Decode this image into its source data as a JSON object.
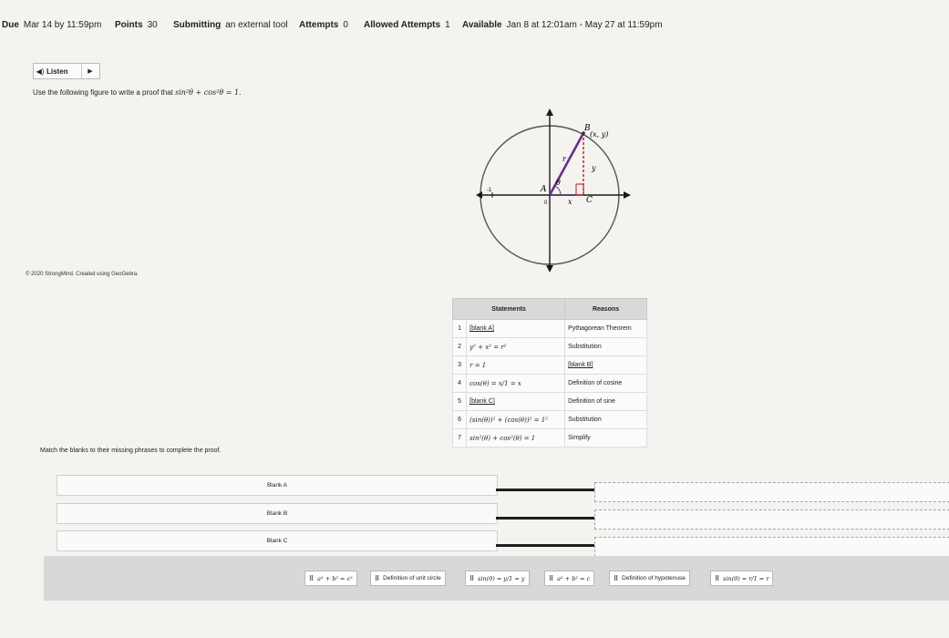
{
  "assignment": {
    "due_label": "Due",
    "due_value": "Mar 14 by 11:59pm",
    "points_label": "Points",
    "points_value": "30",
    "submitting_label": "Submitting",
    "submitting_value": "an external tool",
    "attempts_label": "Attempts",
    "attempts_value": "0",
    "allowed_label": "Allowed Attempts",
    "allowed_value": "1",
    "available_label": "Available",
    "available_value": "Jan 8 at 12:01am - May 27 at 11:59pm"
  },
  "listen": {
    "label": "Listen",
    "speaker_icon": "speaker-icon",
    "play_icon": "play-icon"
  },
  "question": {
    "prompt": "Use the following figure to write a proof that",
    "formula": "sin²θ + cos²θ = 1."
  },
  "figure": {
    "point_a": "A",
    "point_b": "B",
    "point_c": "C",
    "coord_label": "(x, y)",
    "r_label": "r",
    "y_label": "y",
    "x_label": "x",
    "theta_label": "θ",
    "origin_label": "0",
    "neg_tick": "-1",
    "copyright": "© 2020 StrongMind. Created using GeoGebra."
  },
  "proof_table": {
    "headers": [
      "Statements",
      "Reasons"
    ],
    "rows": [
      {
        "num": "1",
        "statement": "[blank A]",
        "reason": "Pythagorean Theorem"
      },
      {
        "num": "2",
        "statement": "y² + x² = r²",
        "reason": "Substitution"
      },
      {
        "num": "3",
        "statement": "r = 1",
        "reason": "[blank B]"
      },
      {
        "num": "4",
        "statement": "cos(θ) = x/1 = x",
        "reason": "Definition of cosine"
      },
      {
        "num": "5",
        "statement": "[blank C]",
        "reason": "Definition of sine"
      },
      {
        "num": "6",
        "statement": "(sin(θ))² + (cos(θ))² = 1²",
        "reason": "Substitution"
      },
      {
        "num": "7",
        "statement": "sin²(θ) + cos²(θ) = 1",
        "reason": "Simplify"
      }
    ]
  },
  "matching": {
    "instruction": "Match the blanks to their missing phrases to complete the proof.",
    "blanks": [
      "Blank A",
      "Blank B",
      "Blank C"
    ]
  },
  "answer_bank": [
    {
      "text": "a² + b² = c²",
      "math": true
    },
    {
      "text": "Definition of unit circle",
      "math": false
    },
    {
      "text": "sin(θ) = y/1 = y",
      "math": true
    },
    {
      "text": "a² + b² = c",
      "math": true
    },
    {
      "text": "Definition of hypotenuse",
      "math": false
    },
    {
      "text": "sin(θ) = r/1 = r",
      "math": true
    }
  ],
  "colors": {
    "segment_r": "#6a2f8e",
    "segment_y": "#c0141b",
    "right_angle": "#c0141b",
    "axes": "#1a1a1a",
    "circle": "#555555"
  }
}
